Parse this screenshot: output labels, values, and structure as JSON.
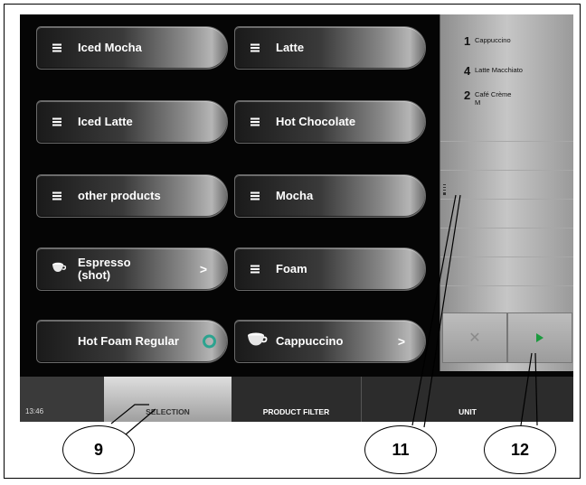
{
  "products": [
    {
      "label": "Iced Mocha",
      "icon": "list-icon"
    },
    {
      "label": "Latte",
      "icon": "list-icon"
    },
    {
      "label": "Iced Latte",
      "icon": "list-icon"
    },
    {
      "label": "Hot Chocolate",
      "icon": "list-icon"
    },
    {
      "label": "other products",
      "icon": "list-icon"
    },
    {
      "label": "Mocha",
      "icon": "list-icon"
    },
    {
      "label": "Espresso\n(shot)",
      "icon": "cup-icon",
      "trailing": ">"
    },
    {
      "label": "Foam",
      "icon": "list-icon"
    },
    {
      "label": "Hot Foam Regular",
      "icon": "none",
      "trailing_icon": "ring-icon"
    },
    {
      "label": "Cappuccino",
      "icon": "cup-icon",
      "trailing": ">"
    }
  ],
  "orders": [
    {
      "qty": "1",
      "name": "Cappuccino"
    },
    {
      "qty": "4",
      "name": "Latte Macchiato"
    },
    {
      "qty": "2",
      "name": "Café Crème\nM"
    }
  ],
  "controls": {
    "cancel": "✕",
    "start_icon": "play-icon"
  },
  "bottom_bar": {
    "time": "13:46",
    "tabs": [
      "SELECTION",
      "PRODUCT FILTER",
      "UNIT"
    ]
  },
  "callouts": [
    "9",
    "11",
    "12"
  ],
  "colors": {
    "ring": "#2ca38f",
    "play": "#1b9a3e",
    "screen_bg": "#050505"
  }
}
